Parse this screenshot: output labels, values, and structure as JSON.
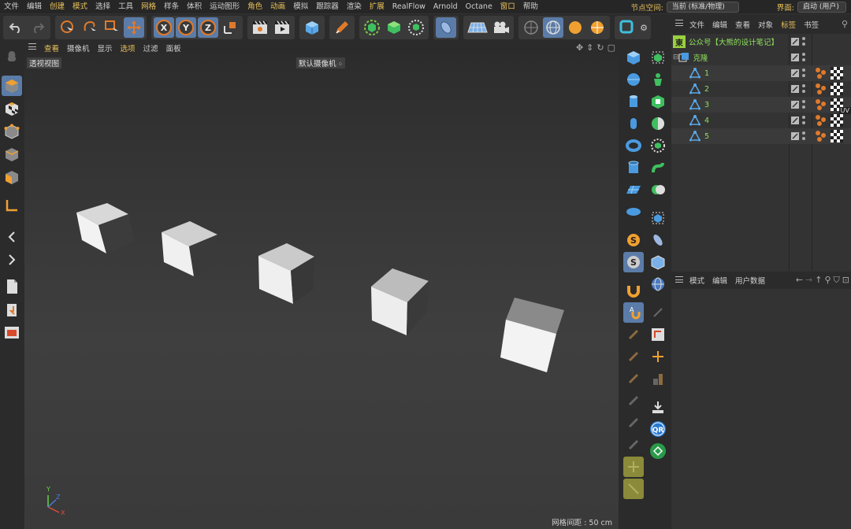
{
  "menubar": {
    "items": [
      {
        "label": "文件",
        "hl": false
      },
      {
        "label": "编辑",
        "hl": false
      },
      {
        "label": "创建",
        "hl": true
      },
      {
        "label": "模式",
        "hl": true
      },
      {
        "label": "选择",
        "hl": false
      },
      {
        "label": "工具",
        "hl": false
      },
      {
        "label": "网格",
        "hl": true
      },
      {
        "label": "样条",
        "hl": false
      },
      {
        "label": "体积",
        "hl": false
      },
      {
        "label": "运动图形",
        "hl": false
      },
      {
        "label": "角色",
        "hl": true
      },
      {
        "label": "动画",
        "hl": true
      },
      {
        "label": "模拟",
        "hl": false
      },
      {
        "label": "跟踪器",
        "hl": false
      },
      {
        "label": "渲染",
        "hl": false
      },
      {
        "label": "扩展",
        "hl": true
      },
      {
        "label": "RealFlow",
        "hl": false
      },
      {
        "label": "Arnold",
        "hl": false
      },
      {
        "label": "Octane",
        "hl": false
      },
      {
        "label": "窗口",
        "hl": true
      },
      {
        "label": "帮助",
        "hl": false
      }
    ],
    "node_space_label": "节点空间:",
    "node_space_value": "当前 (标准/物理)",
    "layout_label": "界面:",
    "layout_value": "启动 (用户)"
  },
  "viewport": {
    "menu": [
      {
        "label": "查看",
        "hl": true
      },
      {
        "label": "摄像机",
        "hl": false
      },
      {
        "label": "显示",
        "hl": false
      },
      {
        "label": "选项",
        "hl": true
      },
      {
        "label": "过滤",
        "hl": false
      },
      {
        "label": "面板",
        "hl": false
      }
    ],
    "view_name": "透视视图",
    "camera_name": "默认摄像机",
    "grid_spacing": "网格间距 : 50 cm",
    "axis": {
      "x": "X",
      "y": "Y",
      "z": "Z"
    }
  },
  "object_manager": {
    "menu": [
      {
        "label": "文件",
        "hl": false
      },
      {
        "label": "编辑",
        "hl": false
      },
      {
        "label": "查看",
        "hl": false
      },
      {
        "label": "对象",
        "hl": false
      },
      {
        "label": "标签",
        "hl": true
      },
      {
        "label": "书签",
        "hl": false
      }
    ],
    "objects": [
      {
        "name": "公众号【大熊的设计笔记】",
        "indent": 0,
        "icon": "null-object-icon"
      },
      {
        "name": "克隆",
        "indent": 1,
        "icon": "cloner-icon"
      },
      {
        "name": "1",
        "indent": 2,
        "icon": "joint-icon"
      },
      {
        "name": "2",
        "indent": 2,
        "icon": "joint-icon"
      },
      {
        "name": "3",
        "indent": 2,
        "icon": "joint-icon"
      },
      {
        "name": "4",
        "indent": 2,
        "icon": "joint-icon"
      },
      {
        "name": "5",
        "indent": 2,
        "icon": "joint-icon"
      }
    ],
    "tooltip_fragment": "UV"
  },
  "attribute_manager": {
    "menu": [
      {
        "label": "模式"
      },
      {
        "label": "编辑"
      },
      {
        "label": "用户数据"
      }
    ]
  },
  "colors": {
    "accent_yellow": "#e8c15a",
    "active_blue": "#5b7ca8",
    "object_green": "#8ee05c",
    "orange": "#e07a2a"
  }
}
